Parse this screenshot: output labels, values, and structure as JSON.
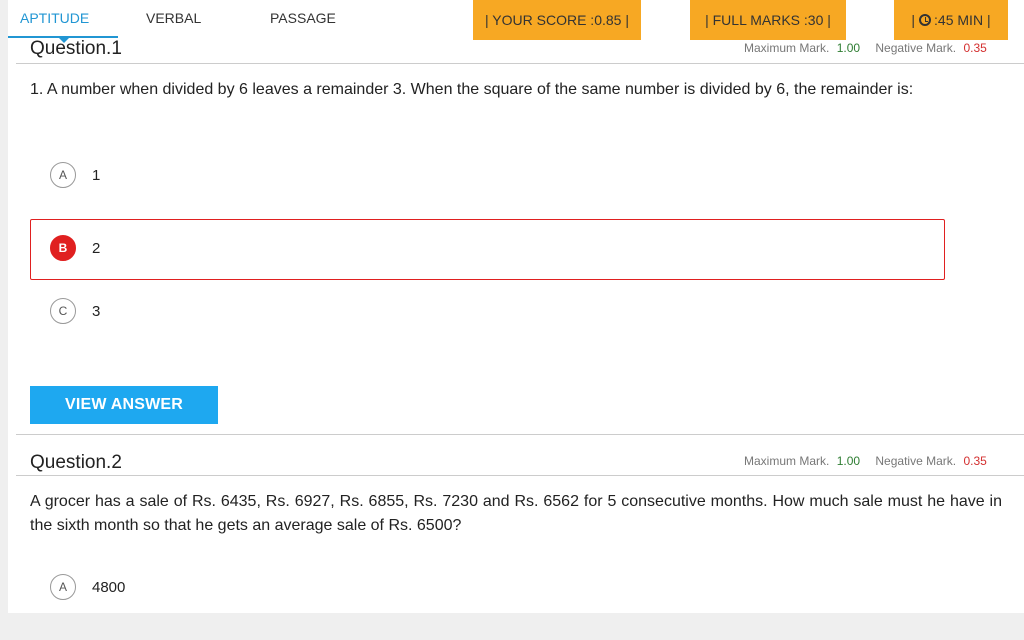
{
  "nav": {
    "tabs": [
      {
        "label": "APTITUDE",
        "active": true
      },
      {
        "label": "VERBAL",
        "active": false
      },
      {
        "label": "PASSAGE",
        "active": false
      }
    ],
    "score_label": "| YOUR SCORE :0.85 |",
    "full_marks_label": "| FULL MARKS :30 |",
    "timer_prefix": "|",
    "timer_label": ":45 MIN |"
  },
  "colors": {
    "accent": "#2196d3",
    "pill": "#f7a823",
    "selected": "#e02020",
    "button": "#1ea8f0"
  },
  "questions": [
    {
      "title": "Question.1",
      "max_label": "Maximum Mark.",
      "max_value": "1.00",
      "neg_label": "Negative Mark.",
      "neg_value": "0.35",
      "text": "1. A number when divided by 6 leaves a remainder 3. When the square of the same number is divided by 6, the remainder is:",
      "options": [
        {
          "letter": "A",
          "text": "1",
          "selected": false
        },
        {
          "letter": "B",
          "text": "2",
          "selected": true
        },
        {
          "letter": "C",
          "text": "3",
          "selected": false
        }
      ],
      "view_answer": "VIEW ANSWER"
    },
    {
      "title": "Question.2",
      "max_label": "Maximum Mark.",
      "max_value": "1.00",
      "neg_label": "Negative Mark.",
      "neg_value": "0.35",
      "text": "A grocer has a sale of Rs. 6435, Rs. 6927, Rs. 6855, Rs. 7230 and Rs. 6562 for 5 consecutive months. How much sale must he have in the sixth month so that he gets an average sale of Rs. 6500?",
      "options": [
        {
          "letter": "A",
          "text": "4800",
          "selected": false
        }
      ]
    }
  ]
}
